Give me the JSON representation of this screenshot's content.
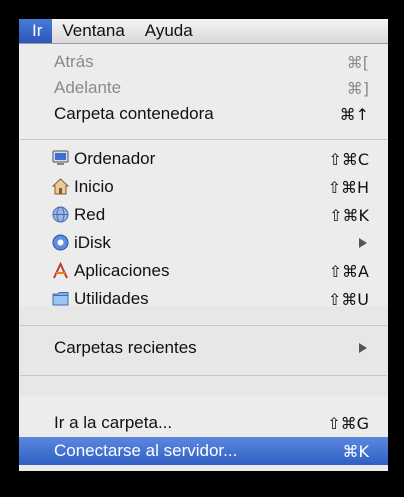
{
  "menubar": {
    "items": [
      {
        "label": "Ir",
        "active": true
      },
      {
        "label": "Ventana",
        "active": false
      },
      {
        "label": "Ayuda",
        "active": false
      }
    ]
  },
  "menu": {
    "items": [
      {
        "label": "Atrás",
        "shortcut": "⌘[",
        "disabled": true
      },
      {
        "label": "Adelante",
        "shortcut": "⌘]",
        "disabled": true
      },
      {
        "label": "Carpeta contenedora",
        "shortcut": "⌘↑",
        "disabled": false
      },
      {
        "label": "Ordenador",
        "shortcut": "⇧⌘C",
        "icon": "computer-icon"
      },
      {
        "label": "Inicio",
        "shortcut": "⇧⌘H",
        "icon": "home-icon"
      },
      {
        "label": "Red",
        "shortcut": "⇧⌘K",
        "icon": "network-icon"
      },
      {
        "label": "iDisk",
        "submenu": true,
        "icon": "idisk-icon"
      },
      {
        "label": "Aplicaciones",
        "shortcut": "⇧⌘A",
        "icon": "applications-icon"
      },
      {
        "label": "Utilidades",
        "shortcut": "⇧⌘U",
        "icon": "utilities-folder-icon"
      },
      {
        "label": "Carpetas recientes",
        "submenu": true
      },
      {
        "label": "Ir a la carpeta...",
        "shortcut": "⇧⌘G"
      },
      {
        "label": "Conectarse al servidor...",
        "shortcut": "⌘K",
        "selected": true
      }
    ]
  },
  "colors": {
    "highlight": "#3a6bd0",
    "menu_bg": "#ececec",
    "disabled_text": "#8a8a8a"
  }
}
